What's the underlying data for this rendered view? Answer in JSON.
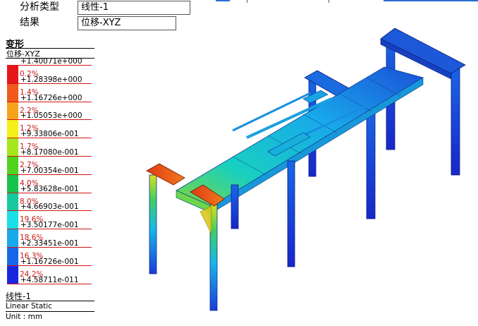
{
  "header": {
    "analysis_type_label": "分析类型",
    "analysis_type_value": "线性-1",
    "result_label": "结果",
    "result_value": "位移-XYZ"
  },
  "legend": {
    "title": "变形",
    "subtitle": "位移-XYZ",
    "values": [
      "+1.40071e+000",
      "+1.28398e+000",
      "+1.16726e+000",
      "+1.05053e+000",
      "+9.33806e-001",
      "+8.17080e-001",
      "+7.00354e-001",
      "+5.83628e-001",
      "+4.66903e-001",
      "+3.50177e-001",
      "+2.33451e-001",
      "+1.16726e-001",
      "+4.58711e-011"
    ],
    "percentages": [
      "0.2%",
      "1.4%",
      "2.2%",
      "1.2%",
      "1.7%",
      "2.7%",
      "4.0%",
      "8.0%",
      "19.6%",
      "18.6%",
      "16.3%",
      "24.2%"
    ],
    "colors": [
      "#e8151b",
      "#f05a1a",
      "#f6a31c",
      "#f5f018",
      "#a7e61d",
      "#4fd31f",
      "#19c24c",
      "#17c99d",
      "#18e0e6",
      "#18a9ea",
      "#1967e6",
      "#1826e0"
    ]
  },
  "footer": {
    "case_name": "线性-1",
    "analysis_kind": "Linear Static",
    "unit": "Unit : mm"
  }
}
